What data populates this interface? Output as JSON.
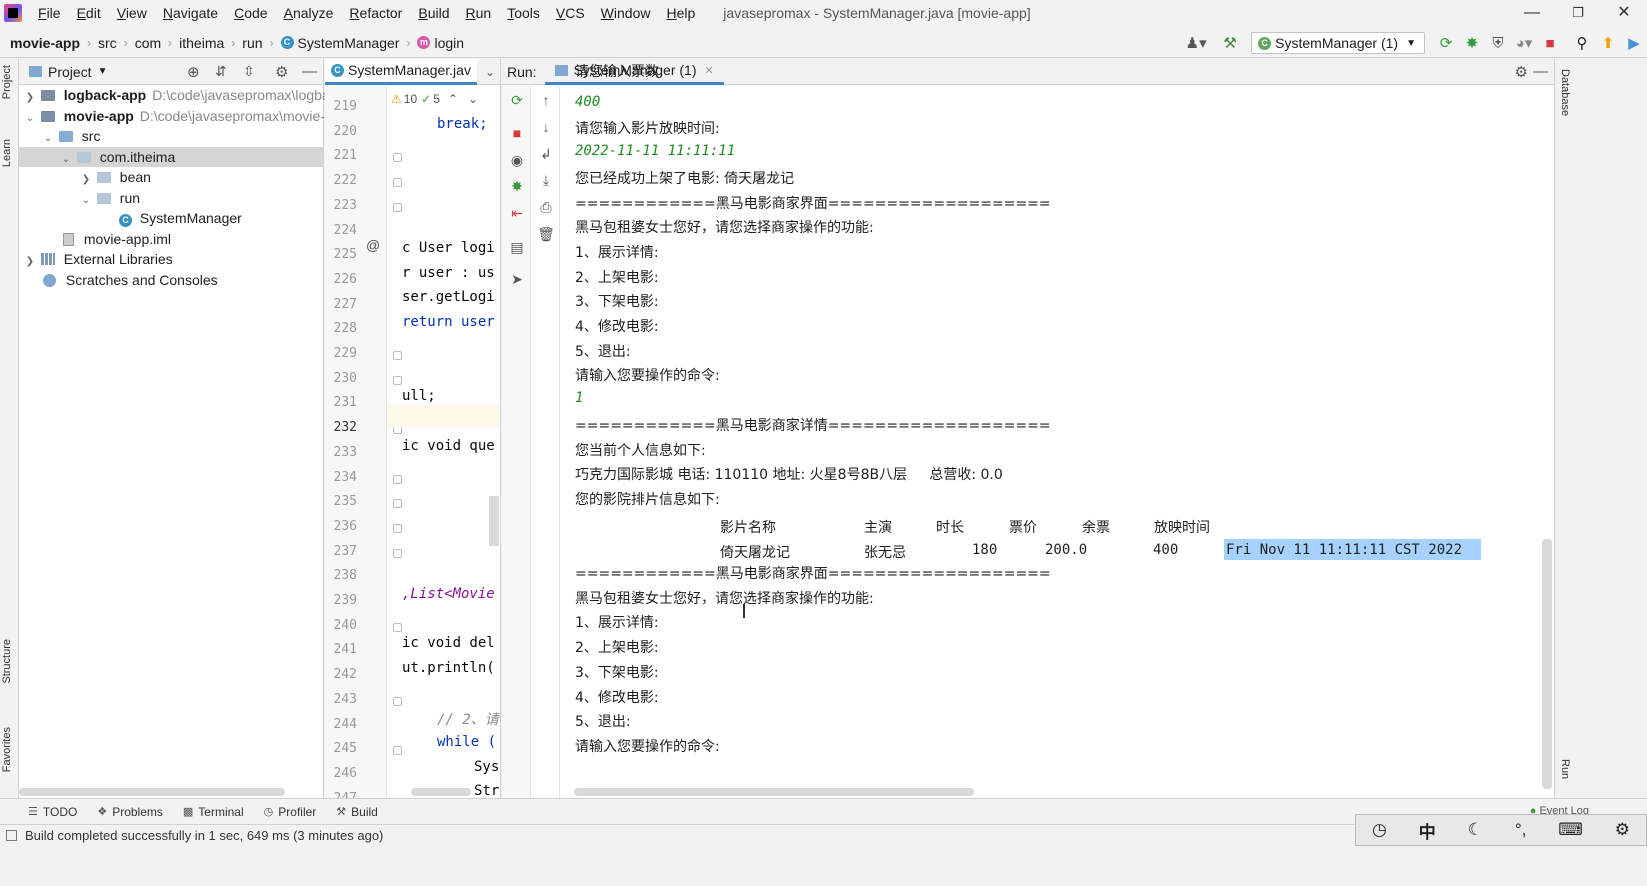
{
  "menu": {
    "items": [
      "File",
      "Edit",
      "View",
      "Navigate",
      "Code",
      "Analyze",
      "Refactor",
      "Build",
      "Run",
      "Tools",
      "VCS",
      "Window",
      "Help"
    ],
    "window_title": "javasepromax - SystemManager.java [movie-app]"
  },
  "breadcrumb": {
    "items": [
      "movie-app",
      "src",
      "com",
      "itheima",
      "run",
      "SystemManager",
      "login"
    ]
  },
  "toolbar": {
    "run_config": "SystemManager (1)"
  },
  "left_stripe": {
    "project": "Project",
    "learn": "Learn",
    "structure": "Structure",
    "favorites": "Favorites"
  },
  "right_stripe": {
    "database": "Database",
    "run": "Run"
  },
  "project": {
    "title": "Project",
    "tree": [
      {
        "label": "logback-app",
        "path": "D:\\code\\javasepromax\\logba"
      },
      {
        "label": "movie-app",
        "path": "D:\\code\\javasepromax\\movie-a"
      },
      {
        "label": "src"
      },
      {
        "label": "com.itheima"
      },
      {
        "label": "bean"
      },
      {
        "label": "run"
      },
      {
        "label": "SystemManager"
      },
      {
        "label": "movie-app.iml"
      },
      {
        "label": "External Libraries"
      },
      {
        "label": "Scratches and Consoles"
      }
    ]
  },
  "editor": {
    "tab": "SystemManager.jav",
    "warnings": "10",
    "checks": "5",
    "line_numbers": [
      "219",
      "220",
      "221",
      "222",
      "223",
      "224",
      "225",
      "226",
      "227",
      "228",
      "229",
      "230",
      "231",
      "232",
      "233",
      "234",
      "235",
      "236",
      "237",
      "238",
      "239",
      "240",
      "241",
      "242",
      "243",
      "244",
      "245",
      "246",
      "247"
    ],
    "code": {
      "l220": "break;",
      "l225": "c User logi",
      "l226": "r user : us",
      "l227": "ser.getLogi",
      "l228": "return user",
      "l231": "ull;",
      "l233": "ic void que",
      "l239": ",List<Movie",
      "l241": "ic void del",
      "l242": "ut.println(",
      "l244": "// 2、请",
      "l245": "while (",
      "l246": "Sys",
      "l247": "Str"
    }
  },
  "run": {
    "label": "Run:",
    "tab": "SystemManager (1)",
    "console": [
      "请您输入票数:",
      "400",
      "请您输入影片放映时间:",
      "2022-11-11 11:11:11",
      "您已经成功上架了电影: 倚天屠龙记",
      "============黑马电影商家界面===================",
      "黑马包租婆女士您好，请您选择商家操作的功能:",
      "1、展示详情:",
      "2、上架电影:",
      "3、下架电影:",
      "4、修改电影:",
      "5、退出:",
      "请输入您要操作的命令:",
      "1",
      "============黑马电影商家详情===================",
      "您当前个人信息如下:",
      "巧克力国际影城 电话: 110110 地址: 火星8号8B八层     总营收: 0.0",
      "您的影院排片信息如下:",
      "",
      "",
      "============黑马电影商家界面===================",
      "黑马包租婆女士您好，请您选择商家操作的功能:",
      "1、展示详情:",
      "2、上架电影:",
      "3、下架电影:",
      "4、修改电影:",
      "5、退出:",
      "请输入您要操作的命令:"
    ],
    "table_headers": [
      "影片名称",
      "主演",
      "时长",
      "票价",
      "余票",
      "放映时间"
    ],
    "table_row": [
      "倚天屠龙记",
      "张无忌",
      "180",
      "200.0",
      "400",
      "Fri Nov 11 11:11:11 CST 2022"
    ]
  },
  "bottom_tabs": [
    "TODO",
    "Problems",
    "Terminal",
    "Profiler",
    "Build"
  ],
  "status": {
    "message": "Build completed successfully in 1 sec, 649 ms (3 minutes ago)",
    "event_log": "Event Log",
    "ime": "中"
  }
}
